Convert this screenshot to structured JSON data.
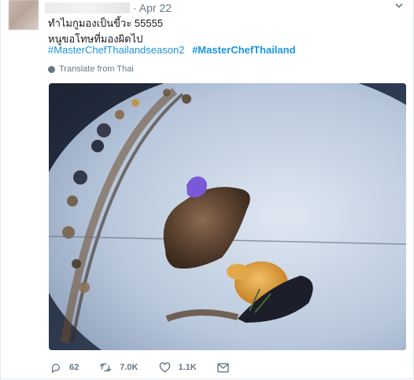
{
  "tweet": {
    "date": "· Apr 22",
    "text_line1": "ทำไมกูมองเป็นขี้วะ 55555",
    "text_line2": "หนูขอโทษที่มองผิดไป",
    "hashtag1": "#MasterChefThailandseason2",
    "hashtag2": "#MasterChefThailand",
    "translate_label": "Translate from Thai"
  },
  "actions": {
    "reply_count": "62",
    "retweet_count": "7.0K",
    "like_count": "1.1K"
  },
  "icons": [
    "chevron-down-icon",
    "globe-icon",
    "reply-icon",
    "retweet-icon",
    "heart-icon",
    "message-icon"
  ],
  "colors": {
    "hashtag": "#1b95e0",
    "meta": "#657786"
  }
}
